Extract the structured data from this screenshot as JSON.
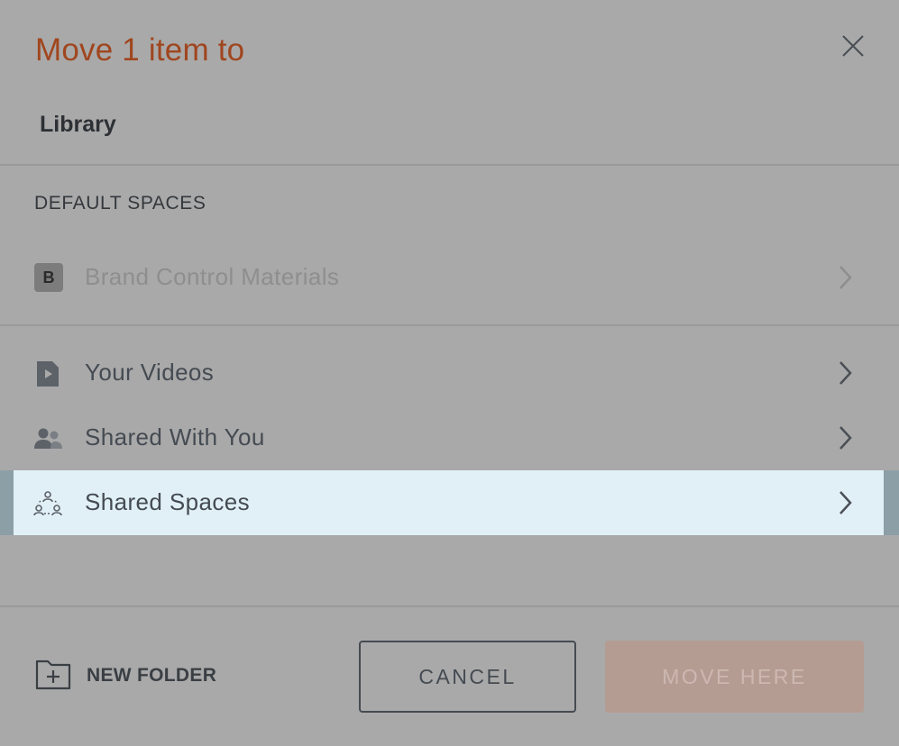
{
  "dialog": {
    "title": "Move 1 item to",
    "breadcrumb": "Library"
  },
  "section": {
    "label": "DEFAULT SPACES"
  },
  "items": [
    {
      "badge": "B",
      "label": "Brand Control Materials",
      "state": "disabled"
    },
    {
      "icon": "video-file-icon",
      "label": "Your Videos",
      "state": "normal"
    },
    {
      "icon": "users-icon",
      "label": "Shared With You",
      "state": "normal"
    },
    {
      "icon": "shared-spaces-icon",
      "label": "Shared Spaces",
      "state": "selected"
    }
  ],
  "footer": {
    "new_folder_label": "NEW FOLDER",
    "cancel_label": "CANCEL",
    "move_label": "MOVE HERE"
  },
  "colors": {
    "title": "#a0461f",
    "selected_row": "#e1f0f7",
    "move_button": "#b59c93",
    "overlay": "#a9a9a9"
  }
}
